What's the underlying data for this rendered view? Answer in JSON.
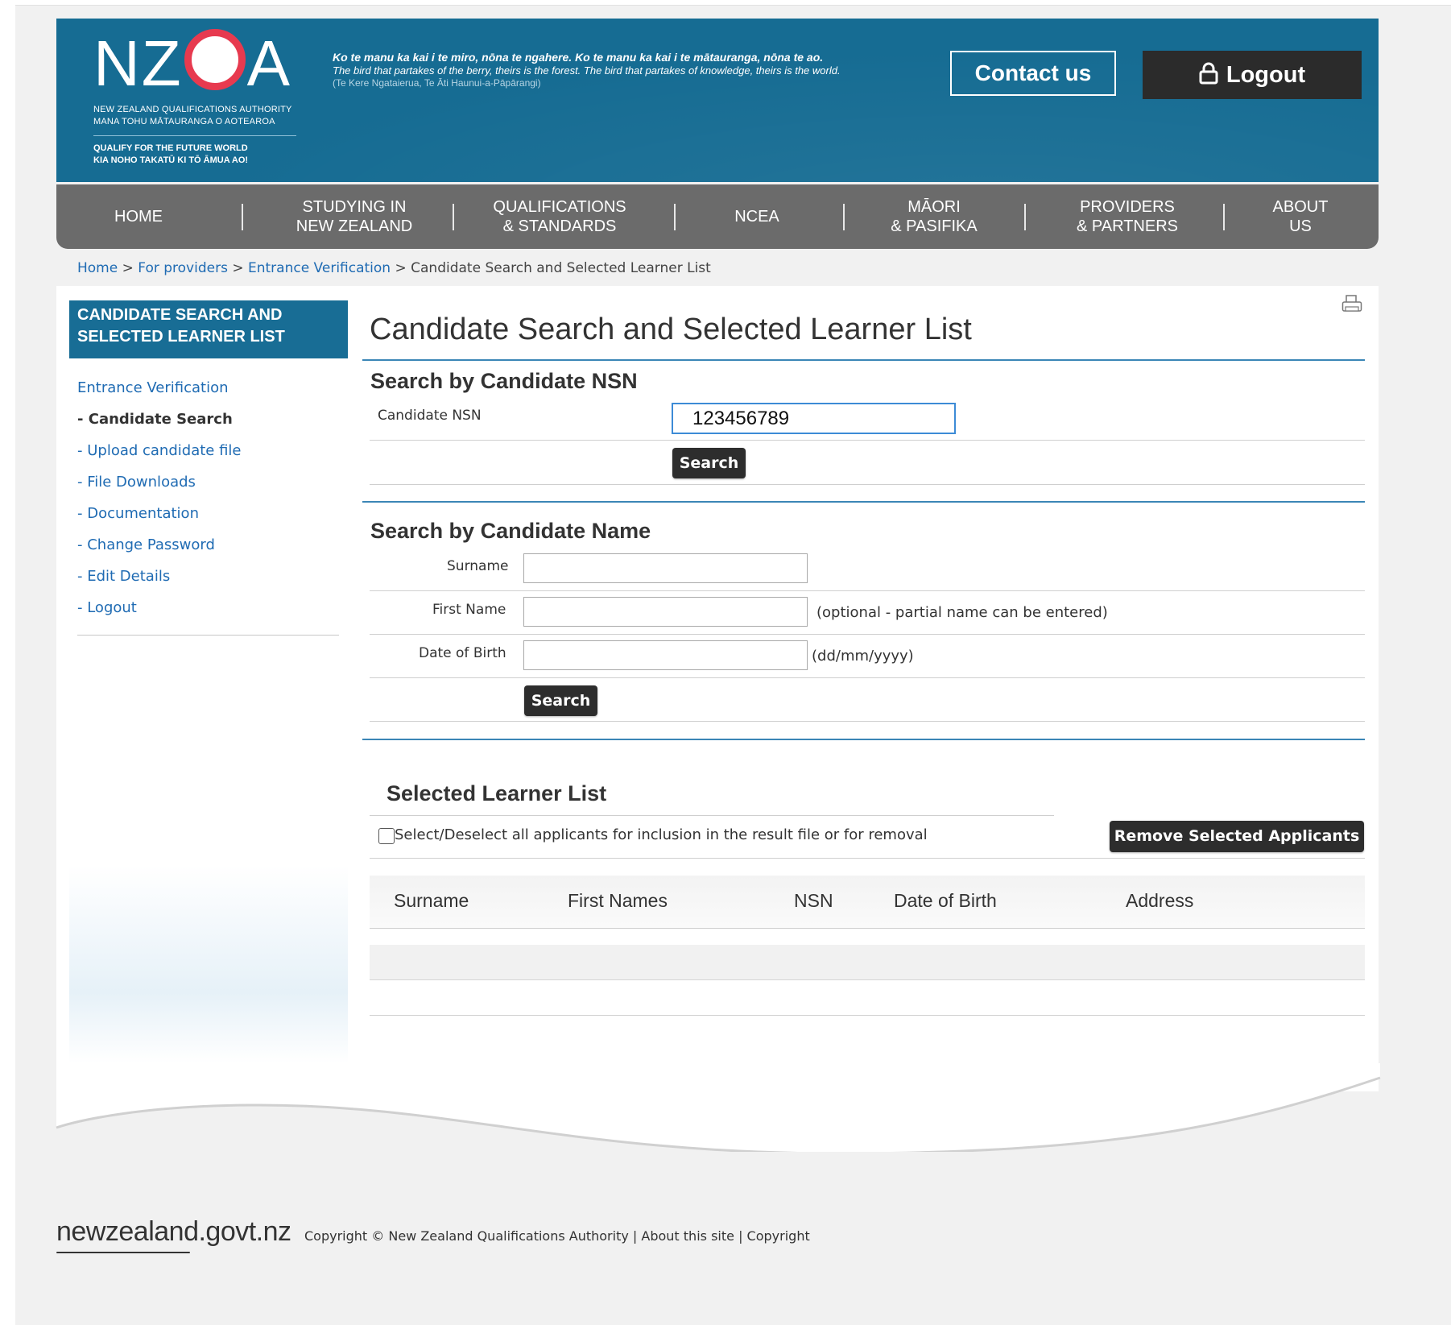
{
  "header": {
    "logo_text": "NZQA",
    "logo_sub": [
      "NEW ZEALAND QUALIFICATIONS AUTHORITY",
      "MANA TOHU MĀTAURANGA O AOTEAROA"
    ],
    "logo_tag": [
      "QUALIFY FOR THE FUTURE WORLD",
      "KIA NOHO TAKATŪ KI TŌ ĀMUA AO!"
    ],
    "proverb_maori": "Ko te manu ka kai i te miro, nōna te ngahere. Ko te manu ka kai i te mātauranga, nōna te ao.",
    "proverb_english": "The bird that partakes of the berry, theirs is the forest. The bird that partakes of knowledge, theirs is the world.",
    "proverb_source": "(Te Kere Ngataierua, Te Āti Haunui-a-Pāpārangi)",
    "contact_label": "Contact us",
    "logout_label": "Logout"
  },
  "nav": [
    {
      "label": "HOME"
    },
    {
      "label": "STUDYING IN\nNEW ZEALAND"
    },
    {
      "label": "QUALIFICATIONS\n& STANDARDS"
    },
    {
      "label": "NCEA"
    },
    {
      "label": "MĀORI\n& PASIFIKA"
    },
    {
      "label": "PROVIDERS\n& PARTNERS"
    },
    {
      "label": "ABOUT\nUS"
    }
  ],
  "breadcrumb": {
    "items": [
      "Home",
      "For providers",
      "Entrance Verification"
    ],
    "current": "Candidate Search and Selected Learner List",
    "separator": ">"
  },
  "sidebar": {
    "heading": "CANDIDATE SEARCH AND SELECTED LEARNER LIST",
    "items": [
      {
        "label": "Entrance Verification"
      },
      {
        "label": "- Candidate Search"
      },
      {
        "label": "- Upload candidate file"
      },
      {
        "label": "- File Downloads"
      },
      {
        "label": "- Documentation"
      },
      {
        "label": "- Change Password"
      },
      {
        "label": "- Edit Details"
      },
      {
        "label": "- Logout"
      }
    ]
  },
  "main": {
    "title": "Candidate Search and Selected Learner List",
    "nsn_section": {
      "heading": "Search by Candidate NSN",
      "label": "Candidate NSN",
      "value": "123456789",
      "button": "Search"
    },
    "name_section": {
      "heading": "Search by Candidate Name",
      "surname_label": "Surname",
      "surname_value": "",
      "firstname_label": "First Name",
      "firstname_value": "",
      "firstname_hint": "(optional - partial name can be entered)",
      "dob_label": "Date of Birth",
      "dob_value": "",
      "dob_hint": "(dd/mm/yyyy)",
      "button": "Search"
    },
    "learner_list": {
      "heading": "Selected Learner List",
      "select_all_label": "Select/Deselect all applicants for inclusion in the result file or for removal",
      "remove_button": "Remove Selected Applicants",
      "columns": [
        "Surname",
        "First Names",
        "NSN",
        "Date of Birth",
        "Address"
      ]
    }
  },
  "footer": {
    "logo": "newzealand.govt.nz",
    "copyright": "Copyright © New Zealand Qualifications Authority",
    "about": "About this site",
    "copyright_link": "Copyright",
    "separator": "|"
  },
  "colors": {
    "header_blue": "#166c93",
    "nav_grey": "#6b6b6b",
    "link_blue": "#1f6bb3",
    "logo_red": "#e73a4f",
    "button_dark": "#2d2d2d"
  }
}
